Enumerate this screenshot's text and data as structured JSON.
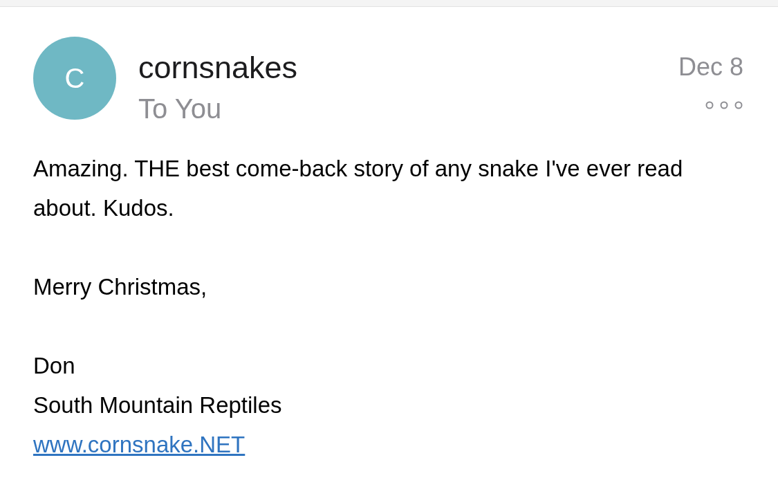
{
  "message": {
    "avatar_letter": "C",
    "sender": "cornsnakes",
    "recipient": "To You",
    "date": "Dec 8",
    "body": [
      "Amazing. THE best come-back story of any snake I've ever read about. Kudos.",
      "Merry Christmas,"
    ],
    "signature": [
      "Don",
      "South Mountain Reptiles"
    ],
    "link": "www.cornsnake.NET"
  }
}
